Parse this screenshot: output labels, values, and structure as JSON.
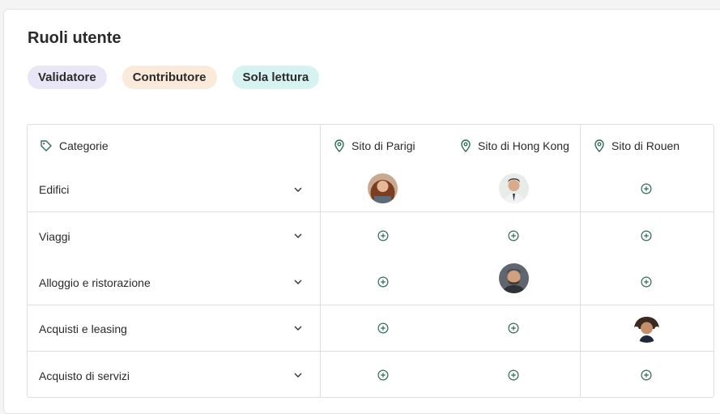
{
  "page": {
    "title": "Ruoli utente"
  },
  "roles": [
    "Validatore",
    "Contributore",
    "Sola lettura"
  ],
  "table": {
    "category_header": "Categorie",
    "sites": [
      "Sito di Parigi",
      "Sito di Hong Kong",
      "Sito di Rouen"
    ],
    "rows": [
      {
        "label": "Edifici",
        "cells": [
          "avatar-woman",
          "avatar-man-suit",
          "add-icon"
        ]
      },
      {
        "label": "Viaggi",
        "cells": [
          "add-icon",
          "add-icon",
          "add-icon"
        ]
      },
      {
        "label": "Alloggio e ristorazione",
        "cells": [
          "add-icon",
          "avatar-man-beard",
          "add-icon"
        ]
      },
      {
        "label": "Acquisti e leasing",
        "cells": [
          "add-icon",
          "add-icon",
          "avatar-woman-dark"
        ]
      },
      {
        "label": "Acquisto di servizi",
        "cells": [
          "add-icon",
          "add-icon",
          "add-icon"
        ]
      }
    ]
  },
  "colors": {
    "icon_green": "#2e6b57",
    "validator": "#e9e6f6",
    "contributor": "#fbe9d9",
    "readonly": "#d6f3f1"
  }
}
